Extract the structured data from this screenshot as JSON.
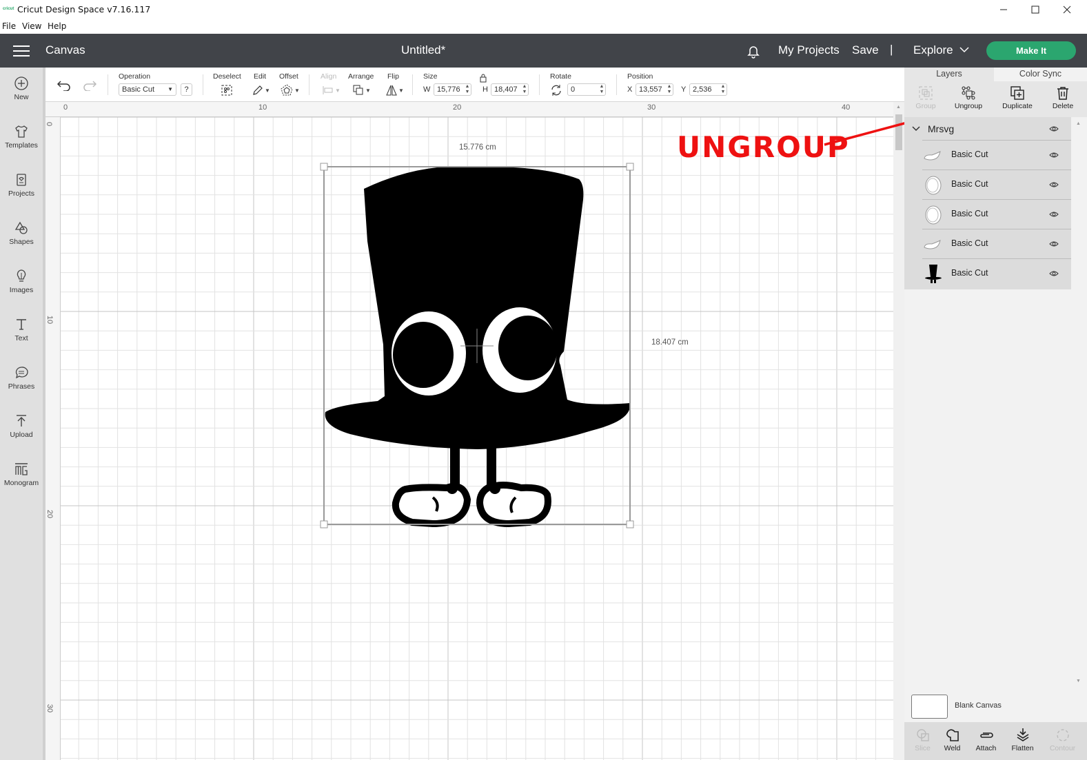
{
  "window": {
    "logo_text": "cricut",
    "title": "Cricut Design Space  v7.16.117",
    "controls": [
      "minimize",
      "maximize",
      "close"
    ]
  },
  "menubar": [
    "File",
    "View",
    "Help"
  ],
  "header": {
    "section": "Canvas",
    "document_title": "Untitled*",
    "my_projects": "My Projects",
    "save": "Save",
    "separator": "|",
    "explore": "Explore",
    "make_it": "Make It",
    "accent_color": "#2ba66f"
  },
  "sidebar": {
    "items": [
      {
        "label": "New",
        "icon": "plus-circle-icon"
      },
      {
        "label": "Templates",
        "icon": "tshirt-icon"
      },
      {
        "label": "Projects",
        "icon": "projects-icon"
      },
      {
        "label": "Shapes",
        "icon": "shapes-icon"
      },
      {
        "label": "Images",
        "icon": "lightbulb-icon"
      },
      {
        "label": "Text",
        "icon": "text-icon"
      },
      {
        "label": "Phrases",
        "icon": "speech-bubble-icon"
      },
      {
        "label": "Upload",
        "icon": "upload-icon"
      },
      {
        "label": "Monogram",
        "icon": "monogram-icon"
      }
    ]
  },
  "toolbar": {
    "operation_label": "Operation",
    "operation_value": "Basic Cut",
    "help": "?",
    "deselect": "Deselect",
    "edit": "Edit",
    "offset": "Offset",
    "align": "Align",
    "arrange": "Arrange",
    "flip": "Flip",
    "size_label": "Size",
    "w_label": "W",
    "w_value": "15,776",
    "h_label": "H",
    "h_value": "18,407",
    "rotate_label": "Rotate",
    "rotate_value": "0",
    "position_label": "Position",
    "x_label": "X",
    "x_value": "13,557",
    "y_label": "Y",
    "y_value": "2,536"
  },
  "rulers": {
    "top": [
      "0",
      "10",
      "20",
      "30",
      "40"
    ],
    "left": [
      "0",
      "10",
      "20",
      "30"
    ]
  },
  "canvas": {
    "width_label": "15.776 cm",
    "height_label": "18.407 cm"
  },
  "annotation": {
    "text": "UNGROUP",
    "color": "#ee1111"
  },
  "right_panel": {
    "tabs": [
      "Layers",
      "Color Sync"
    ],
    "actions": [
      {
        "label": "Group",
        "enabled": false
      },
      {
        "label": "Ungroup",
        "enabled": true
      },
      {
        "label": "Duplicate",
        "enabled": true
      },
      {
        "label": "Delete",
        "enabled": true
      }
    ],
    "group_name": "Mrsvg",
    "layers": [
      {
        "name": "Basic Cut",
        "thumb": "shoe-shape"
      },
      {
        "name": "Basic Cut",
        "thumb": "eye-ring"
      },
      {
        "name": "Basic Cut",
        "thumb": "eye-ring"
      },
      {
        "name": "Basic Cut",
        "thumb": "shoe-shape"
      },
      {
        "name": "Basic Cut",
        "thumb": "top-hat"
      }
    ],
    "blank_canvas": "Blank Canvas",
    "bottom_actions": [
      {
        "label": "Slice",
        "enabled": false
      },
      {
        "label": "Weld",
        "enabled": true
      },
      {
        "label": "Attach",
        "enabled": true
      },
      {
        "label": "Flatten",
        "enabled": true
      },
      {
        "label": "Contour",
        "enabled": false
      }
    ]
  }
}
